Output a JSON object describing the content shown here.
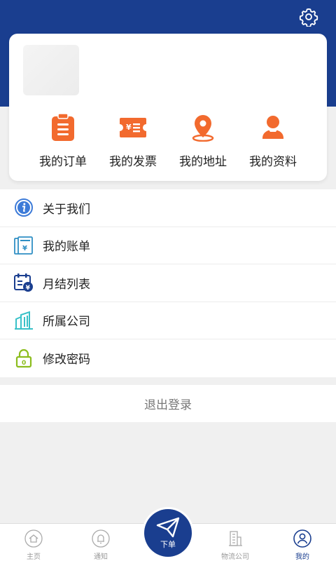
{
  "colors": {
    "brand": "#1a3e8f",
    "accent": "#f26a2e"
  },
  "header": {
    "settings_icon": "gear-icon"
  },
  "quick_actions": [
    {
      "label": "我的订单",
      "icon": "clipboard-icon"
    },
    {
      "label": "我的发票",
      "icon": "invoice-ticket-icon"
    },
    {
      "label": "我的地址",
      "icon": "location-pin-icon"
    },
    {
      "label": "我的资料",
      "icon": "user-profile-icon"
    }
  ],
  "menu": [
    {
      "label": "关于我们",
      "icon": "info-icon"
    },
    {
      "label": "我的账单",
      "icon": "bill-icon"
    },
    {
      "label": "月结列表",
      "icon": "calendar-yen-icon"
    },
    {
      "label": "所属公司",
      "icon": "building-icon"
    },
    {
      "label": "修改密码",
      "icon": "lock-icon"
    }
  ],
  "logout_label": "退出登录",
  "tabbar": {
    "tabs": [
      {
        "label": "主页",
        "icon": "home-icon"
      },
      {
        "label": "通知",
        "icon": "bell-icon"
      },
      {
        "label": "下单",
        "icon": "paper-plane-icon"
      },
      {
        "label": "物流公司",
        "icon": "logistics-building-icon"
      },
      {
        "label": "我的",
        "icon": "user-icon"
      }
    ],
    "active": "我的"
  }
}
